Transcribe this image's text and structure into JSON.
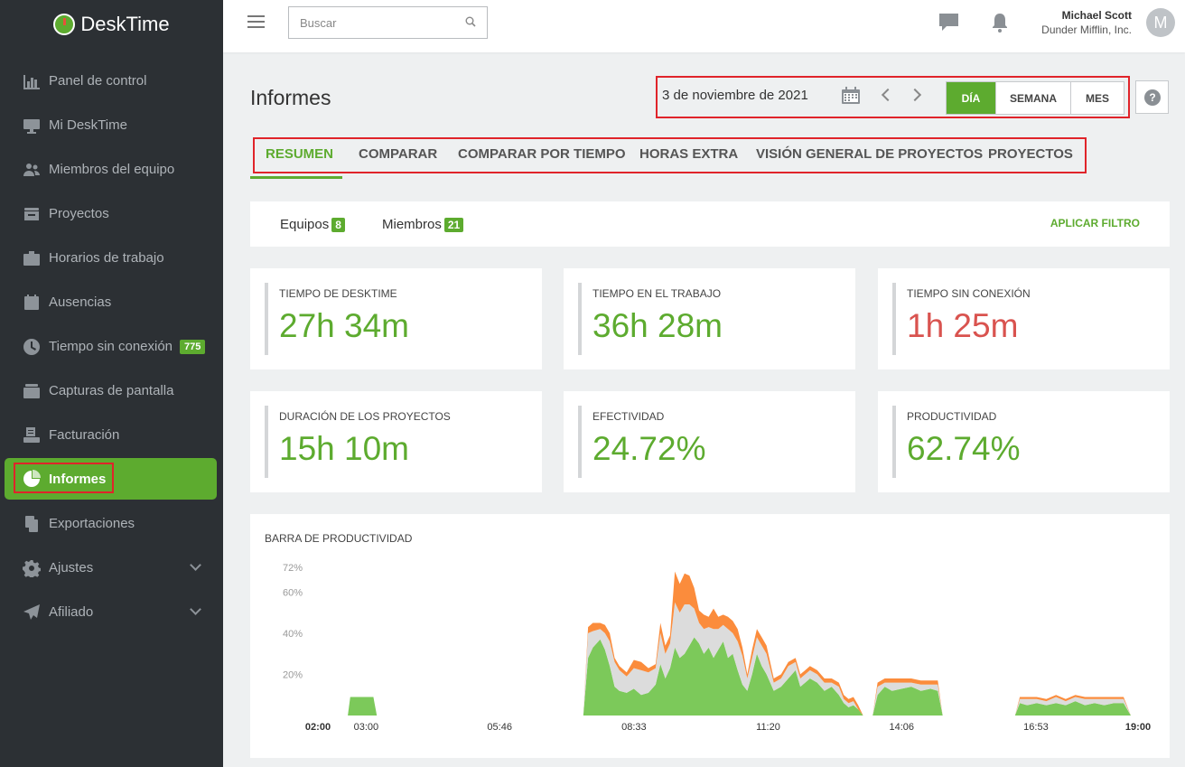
{
  "app": {
    "name": "DeskTime"
  },
  "sidebar": {
    "items": [
      {
        "label": "Panel de control",
        "icon": "bar-chart-icon"
      },
      {
        "label": "Mi DeskTime",
        "icon": "monitor-icon"
      },
      {
        "label": "Miembros del equipo",
        "icon": "team-icon"
      },
      {
        "label": "Proyectos",
        "icon": "inbox-icon"
      },
      {
        "label": "Horarios de trabajo",
        "icon": "briefcase-icon"
      },
      {
        "label": "Ausencias",
        "icon": "calendar-icon"
      },
      {
        "label": "Tiempo sin conexión",
        "icon": "clock-icon",
        "badge": "775"
      },
      {
        "label": "Capturas de pantalla",
        "icon": "folder-icon"
      },
      {
        "label": "Facturación",
        "icon": "invoice-icon"
      },
      {
        "label": "Informes",
        "icon": "pie-chart-icon",
        "active": true
      },
      {
        "label": "Exportaciones",
        "icon": "files-icon"
      },
      {
        "label": "Ajustes",
        "icon": "gear-icon",
        "expandable": true
      },
      {
        "label": "Afiliado",
        "icon": "paper-plane-icon",
        "expandable": true
      }
    ]
  },
  "topbar": {
    "search_placeholder": "Buscar",
    "user_name": "Michael Scott",
    "user_company": "Dunder Mifflin, Inc.",
    "avatar_initial": "M"
  },
  "header": {
    "title": "Informes",
    "date": "3 de noviembre de 2021",
    "periods": [
      "DÍA",
      "SEMANA",
      "MES"
    ],
    "active_period": "DÍA",
    "help": "?"
  },
  "tabs": [
    "RESUMEN",
    "COMPARAR",
    "COMPARAR POR TIEMPO",
    "HORAS EXTRA",
    "VISIÓN GENERAL DE PROYECTOS",
    "PROYECTOS"
  ],
  "active_tab": "RESUMEN",
  "filter": {
    "teams_label": "Equipos",
    "teams_count": "8",
    "members_label": "Miembros",
    "members_count": "21",
    "apply_label": "APLICAR FILTRO"
  },
  "stats": [
    {
      "label": "TIEMPO DE DESKTIME",
      "value": "27h 34m",
      "color": "#5dab2f"
    },
    {
      "label": "TIEMPO EN EL TRABAJO",
      "value": "36h 28m",
      "color": "#5dab2f"
    },
    {
      "label": "TIEMPO SIN CONEXIÓN",
      "value": "1h 25m",
      "color": "#d9534f"
    },
    {
      "label": "DURACIÓN DE LOS PROYECTOS",
      "value": "15h 10m",
      "color": "#5dab2f"
    },
    {
      "label": "EFECTIVIDAD",
      "value": "24.72%",
      "color": "#5dab2f"
    },
    {
      "label": "PRODUCTIVIDAD",
      "value": "62.74%",
      "color": "#5dab2f"
    }
  ],
  "colors": {
    "accent": "#5dab2f",
    "sidebar_bg": "#2c3034",
    "highlight_border": "#e0242a",
    "productive": "#7cc95a",
    "neutral": "#dcdcdc",
    "unproductive": "#fb8c3c"
  },
  "chart_data": {
    "type": "area",
    "title": "BARRA DE PRODUCTIVIDAD",
    "ylim": [
      0,
      72
    ],
    "yticks": [
      "72%",
      "60%",
      "40%",
      "20%"
    ],
    "xticks": [
      "02:00",
      "03:00",
      "05:46",
      "08:33",
      "11:20",
      "14:06",
      "16:53",
      "19:00"
    ],
    "x_range_hours": [
      2,
      19
    ],
    "series_order": [
      "productive",
      "neutral",
      "unproductive"
    ],
    "segments": [
      {
        "x": [
          2.62,
          2.67,
          3.15,
          3.22
        ],
        "productive": [
          0,
          9,
          9,
          0
        ],
        "neutral": [
          0,
          0,
          0,
          0
        ],
        "unproductive": [
          0,
          0,
          0,
          0
        ]
      },
      {
        "x": [
          7.5,
          7.6,
          7.7,
          7.85,
          7.95,
          8.05,
          8.15,
          8.25,
          8.4,
          8.55,
          8.7,
          8.85,
          9.0,
          9.1,
          9.2,
          9.3,
          9.4,
          9.5,
          9.6,
          9.7,
          9.8,
          9.9,
          10.0,
          10.1,
          10.2,
          10.3,
          10.4,
          10.5,
          10.6,
          10.7,
          10.8,
          10.9,
          11.0,
          11.1,
          11.2,
          11.3,
          11.45,
          11.6,
          11.75,
          11.9,
          12.0,
          12.1,
          12.2,
          12.35,
          12.5,
          12.65,
          12.8,
          12.9,
          13.0,
          13.1,
          13.2,
          13.3
        ],
        "productive": [
          0,
          28,
          33,
          37,
          32,
          24,
          14,
          12,
          11,
          13,
          10,
          11,
          15,
          25,
          18,
          23,
          33,
          28,
          30,
          34,
          38,
          35,
          30,
          33,
          28,
          32,
          36,
          28,
          30,
          22,
          15,
          12,
          20,
          30,
          24,
          20,
          12,
          14,
          18,
          22,
          14,
          16,
          18,
          16,
          12,
          14,
          10,
          6,
          4,
          5,
          3,
          0
        ],
        "neutral": [
          0,
          12,
          8,
          5,
          8,
          12,
          12,
          10,
          8,
          10,
          12,
          10,
          8,
          15,
          12,
          12,
          22,
          22,
          24,
          20,
          14,
          10,
          12,
          10,
          14,
          10,
          8,
          14,
          10,
          14,
          14,
          6,
          8,
          8,
          10,
          10,
          4,
          4,
          6,
          4,
          4,
          4,
          4,
          4,
          4,
          2,
          4,
          2,
          2,
          2,
          0,
          0
        ],
        "unproductive": [
          0,
          3,
          4,
          3,
          4,
          4,
          2,
          2,
          2,
          4,
          4,
          2,
          2,
          5,
          4,
          4,
          15,
          14,
          15,
          14,
          10,
          6,
          7,
          5,
          10,
          6,
          5,
          6,
          6,
          6,
          4,
          2,
          4,
          4,
          4,
          4,
          2,
          2,
          2,
          2,
          2,
          2,
          2,
          2,
          2,
          2,
          2,
          2,
          2,
          2,
          2,
          0
        ]
      },
      {
        "x": [
          13.5,
          13.6,
          13.75,
          13.9,
          14.1,
          14.3,
          14.5,
          14.7,
          14.85,
          14.95
        ],
        "productive": [
          0,
          10,
          14,
          12,
          13,
          14,
          12,
          13,
          12,
          0
        ],
        "neutral": [
          0,
          4,
          2,
          4,
          3,
          2,
          3,
          2,
          3,
          0
        ],
        "unproductive": [
          0,
          2,
          2,
          2,
          2,
          2,
          2,
          2,
          2,
          0
        ]
      },
      {
        "x": [
          16.45,
          16.55,
          16.7,
          16.9,
          17.1,
          17.3,
          17.5,
          17.7,
          17.9,
          18.1,
          18.3,
          18.5,
          18.7,
          18.85
        ],
        "productive": [
          0,
          6,
          5,
          6,
          5,
          6,
          5,
          7,
          5,
          6,
          5,
          6,
          6,
          0
        ],
        "neutral": [
          0,
          2,
          3,
          2,
          2,
          3,
          2,
          2,
          3,
          2,
          3,
          2,
          2,
          0
        ],
        "unproductive": [
          0,
          1,
          1,
          1,
          1,
          1,
          1,
          1,
          1,
          1,
          1,
          1,
          1,
          0
        ]
      }
    ]
  }
}
